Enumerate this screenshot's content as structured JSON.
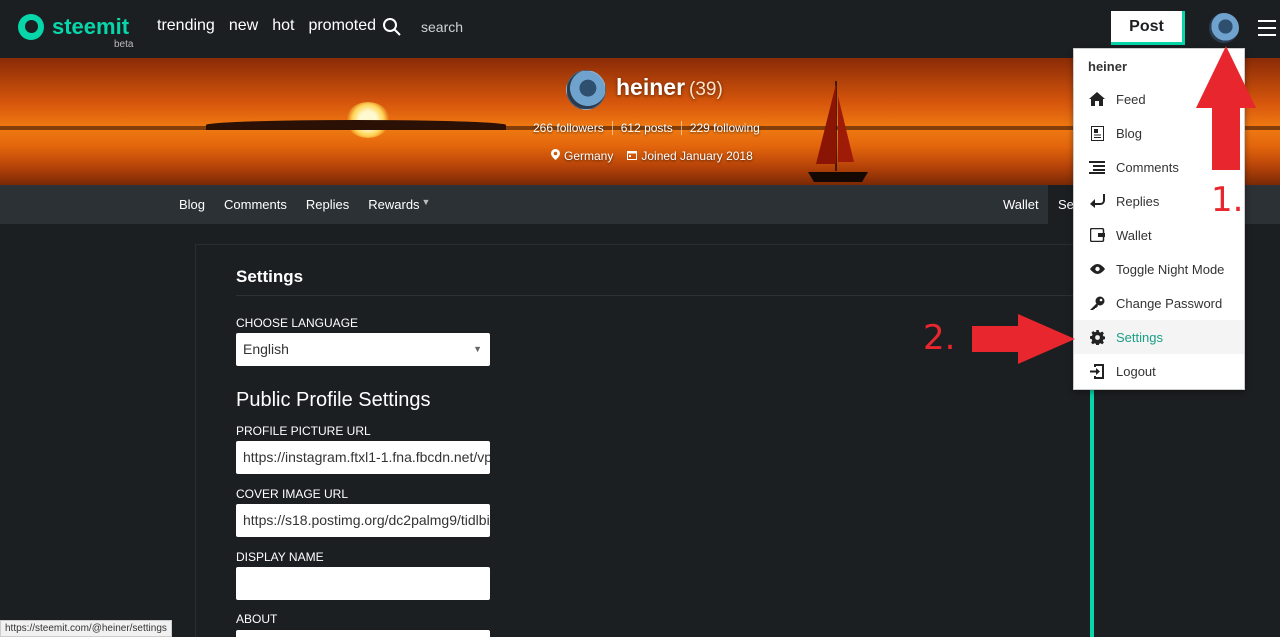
{
  "header": {
    "logo_text": "steemit",
    "logo_badge": "beta",
    "nav": [
      "trending",
      "new",
      "hot",
      "promoted"
    ],
    "search_placeholder": "search",
    "post_label": "Post"
  },
  "profile": {
    "name": "heiner",
    "reputation": "(39)",
    "followers": "266 followers",
    "posts": "612 posts",
    "following": "229 following",
    "location": "Germany",
    "joined": "Joined January 2018"
  },
  "subnav": {
    "tabs": [
      "Blog",
      "Comments",
      "Replies",
      "Rewards"
    ],
    "wallet": "Wallet",
    "settings_partial": "Set"
  },
  "settings": {
    "title": "Settings",
    "choose_language_label": "CHOOSE LANGUAGE",
    "language_value": "English",
    "public_profile_title": "Public Profile Settings",
    "profile_picture_label": "PROFILE PICTURE URL",
    "profile_picture_value": "https://instagram.ftxl1-1.fna.fbcdn.net/vp",
    "cover_image_label": "COVER IMAGE URL",
    "cover_image_value": "https://s18.postimg.org/dc2palmg9/tidlbi",
    "display_name_label": "DISPLAY NAME",
    "display_name_value": "",
    "about_label": "ABOUT"
  },
  "menu": {
    "username": "heiner",
    "items": [
      {
        "label": "Feed",
        "icon": "home-icon"
      },
      {
        "label": "Blog",
        "icon": "blog-icon"
      },
      {
        "label": "Comments",
        "icon": "comments-icon"
      },
      {
        "label": "Replies",
        "icon": "reply-icon"
      },
      {
        "label": "Wallet",
        "icon": "wallet-icon"
      },
      {
        "label": "Toggle Night Mode",
        "icon": "eye-icon"
      },
      {
        "label": "Change Password",
        "icon": "key-icon"
      },
      {
        "label": "Settings",
        "icon": "gear-icon",
        "active": true
      },
      {
        "label": "Logout",
        "icon": "logout-icon"
      }
    ]
  },
  "annotations": {
    "step1": "1.",
    "step2": "2."
  },
  "status_url": "https://steemit.com/@heiner/settings",
  "colors": {
    "accent": "#06d6a9",
    "annotation_red": "#e8262d",
    "background": "#1c1f22"
  }
}
